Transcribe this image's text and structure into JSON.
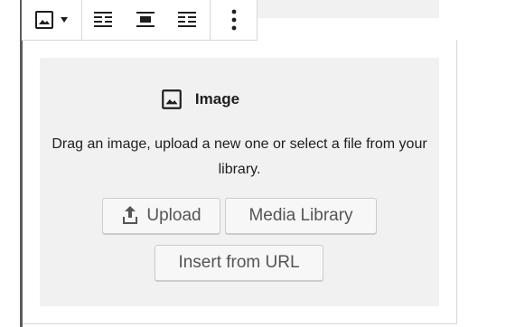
{
  "toolbar": {
    "buttons": [
      {
        "name": "image-block-type",
        "icon": "image-icon",
        "has_dropdown": true
      },
      {
        "name": "align-left",
        "icon": "align-left-icon"
      },
      {
        "name": "align-center",
        "icon": "align-center-icon"
      },
      {
        "name": "align-right",
        "icon": "align-right-icon"
      },
      {
        "name": "more-options",
        "icon": "vertical-ellipsis-icon"
      }
    ]
  },
  "placeholder": {
    "title": "Image",
    "instructions": "Drag an image, upload a new one or select a file from your library.",
    "buttons": {
      "upload": "Upload",
      "media_library": "Media Library",
      "insert_url": "Insert from URL"
    }
  },
  "colors": {
    "panel_bg": "#f1f1f1",
    "text": "#1e1e1e",
    "button_text": "#555555",
    "button_bg": "#f7f7f7",
    "border": "#cccccc",
    "accent_bar": "#5c5c5c"
  }
}
